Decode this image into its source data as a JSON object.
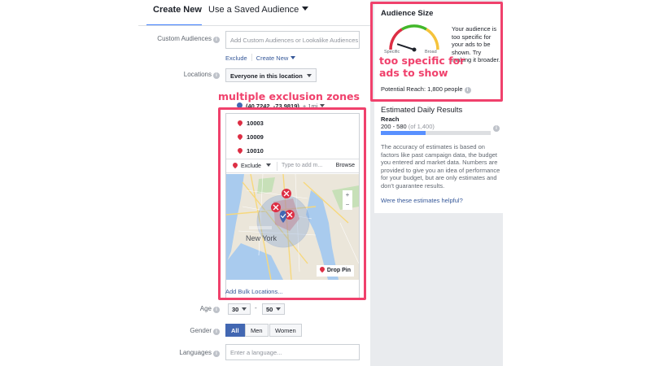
{
  "tabs": {
    "create_new": "Create New",
    "use_saved": "Use a Saved Audience"
  },
  "custom_audiences": {
    "label": "Custom Audiences",
    "placeholder": "Add Custom Audiences or Lookalike Audiences",
    "exclude_link": "Exclude",
    "create_new_link": "Create New"
  },
  "locations": {
    "label": "Locations",
    "scope_dropdown": "Everyone in this location",
    "coordinate": "(40.7242, -73.9819)",
    "radius": "+ 1mi",
    "excluded_zips": [
      "10003",
      "10009",
      "10010"
    ],
    "exclude_mode": "Exclude",
    "search_placeholder": "Type to add m...",
    "browse": "Browse",
    "map_place_label": "New York",
    "zoom_in": "+",
    "zoom_out": "−",
    "drop_pin": "Drop Pin",
    "add_bulk": "Add Bulk Locations..."
  },
  "age": {
    "label": "Age",
    "min": "30",
    "separator": "-",
    "max": "50"
  },
  "gender": {
    "label": "Gender",
    "options": [
      "All",
      "Men",
      "Women"
    ],
    "selected": "All"
  },
  "languages": {
    "label": "Languages",
    "placeholder": "Enter a language..."
  },
  "audience_size": {
    "title": "Audience Size",
    "gauge_left": "Specific",
    "gauge_right": "Broad",
    "gauge_level": 0.1,
    "description": "Your audience is too specific for your ads to be shown. Try making it broader.",
    "potential_reach": "Potential Reach: 1,800 people"
  },
  "estimated_daily": {
    "title": "Estimated Daily Results",
    "reach_label": "Reach",
    "range": "200 - 580",
    "of_total": "(of 1,400)",
    "fill_fraction": 0.41,
    "description": "The accuracy of estimates is based on factors like past campaign data, the budget you entered and market data. Numbers are provided to give you an idea of performance for your budget, but are only estimates and don't guarantee results.",
    "helpful_link": "Were these estimates helpful?"
  },
  "annotations": {
    "exclusion_zones": "multiple exclusion zones",
    "too_specific": "too specific for ads to show",
    "color": "#f0416c"
  },
  "colors": {
    "accent": "#4267b2",
    "link": "#365899",
    "pin_red": "#dd2e44",
    "panel_bg": "#e9ebee",
    "bar_fill": "#5890ff"
  }
}
